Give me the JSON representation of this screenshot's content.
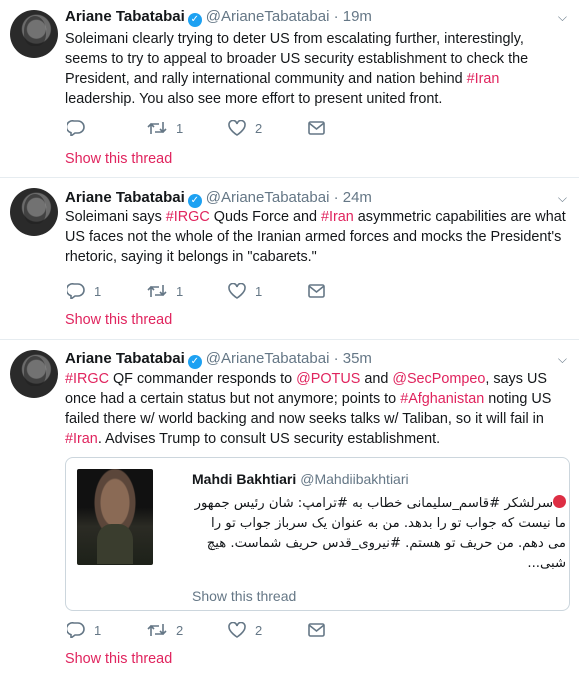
{
  "tweets": [
    {
      "author": "Ariane Tabatabai",
      "handle": "@ArianeTabatabai",
      "time": "19m",
      "text": [
        {
          "t": "Soleimani clearly trying to deter US from escalating further, interestingly, seems to try to appeal to broader US security establishment to check the President, and rally international community and nation behind "
        },
        {
          "t": "#Iran",
          "tag": true
        },
        {
          "t": " leadership. You also see more effort to present united front."
        }
      ],
      "reply_count": "",
      "retweet_count": "1",
      "like_count": "2",
      "show_thread": "Show this thread"
    },
    {
      "author": "Ariane Tabatabai",
      "handle": "@ArianeTabatabai",
      "time": "24m",
      "text": [
        {
          "t": "Soleimani says "
        },
        {
          "t": "#IRGC",
          "tag": true
        },
        {
          "t": " Quds Force and "
        },
        {
          "t": "#Iran",
          "tag": true
        },
        {
          "t": " asymmetric capabilities are what US faces not the whole of the Iranian armed forces and mocks the President's rhetoric, saying it belongs in \"cabarets.\""
        }
      ],
      "reply_count": "1",
      "retweet_count": "1",
      "like_count": "1",
      "show_thread": "Show this thread"
    },
    {
      "author": "Ariane Tabatabai",
      "handle": "@ArianeTabatabai",
      "time": "35m",
      "text": [
        {
          "t": "#IRGC",
          "tag": true
        },
        {
          "t": " QF commander responds to "
        },
        {
          "t": "@POTUS",
          "tag": true
        },
        {
          "t": " and "
        },
        {
          "t": "@SecPompeo",
          "tag": true
        },
        {
          "t": ", says US once had a certain status but not anymore; points to "
        },
        {
          "t": "#Afghanistan",
          "tag": true
        },
        {
          "t": " noting US failed there w/ world backing and now seeks talks w/ Taliban, so it will fail in "
        },
        {
          "t": "#Iran",
          "tag": true
        },
        {
          "t": ". Advises Trump to consult US security establishment."
        }
      ],
      "reply_count": "1",
      "retweet_count": "2",
      "like_count": "2",
      "show_thread": "Show this thread",
      "quote": {
        "author": "Mahdi Bakhtiari",
        "handle": "@Mahdiibakhtiari",
        "text": "سرلشکر #قاسم_سلیمانی خطاب به #ترامپ: شان رئیس جمهور ما نیست که جواب تو را بدهد. من به عنوان یک سرباز جواب تو را می دهم. من حریف تو هستم. #نیروی_قدس حریف شماست. هیچ شبی...",
        "show_thread": "Show this thread"
      }
    }
  ],
  "colors": {
    "accent": "#e0245e",
    "muted": "#657786",
    "verified": "#1da1f2",
    "divider": "#e6ecf0"
  },
  "icons": {
    "reply": "reply-icon",
    "retweet": "retweet-icon",
    "like": "heart-icon",
    "dm": "envelope-icon",
    "verified": "verified-badge-icon",
    "menu": "chevron-down-icon"
  }
}
